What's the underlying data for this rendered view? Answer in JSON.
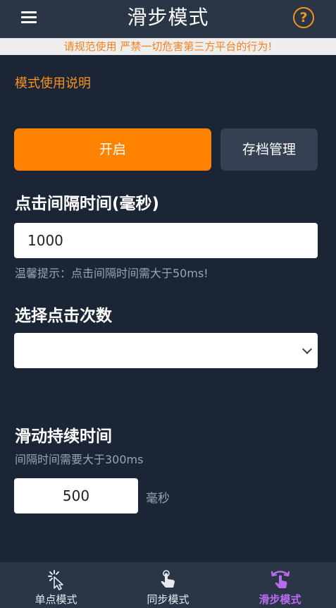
{
  "header": {
    "title": "滑步模式",
    "help_glyph": "?"
  },
  "notice": "请规范使用 严禁一切危害第三方平台的行为!",
  "mode_instructions": "模式使用说明",
  "actions": {
    "start": "开启",
    "archive": "存档管理"
  },
  "click_interval": {
    "label": "点击间隔时间(毫秒)",
    "value": "1000",
    "hint": "温馨提示：点击间隔时间需大于50ms!"
  },
  "click_count": {
    "label": "选择点击次数",
    "selected": ""
  },
  "slide_duration": {
    "label": "滑动持续时间",
    "hint": "间隔时间需要大于300ms",
    "value": "500",
    "unit": "毫秒"
  },
  "bottom_nav": {
    "items": [
      {
        "label": "单点模式",
        "icon": "tap-click-icon",
        "active": false
      },
      {
        "label": "同步模式",
        "icon": "hand-touch-icon",
        "active": false
      },
      {
        "label": "滑步模式",
        "icon": "swipe-icon",
        "active": true
      }
    ]
  },
  "colors": {
    "background": "#1b2535",
    "bar": "#2a3545",
    "accent": "#ff8300",
    "active_tab": "#b86cf0"
  }
}
